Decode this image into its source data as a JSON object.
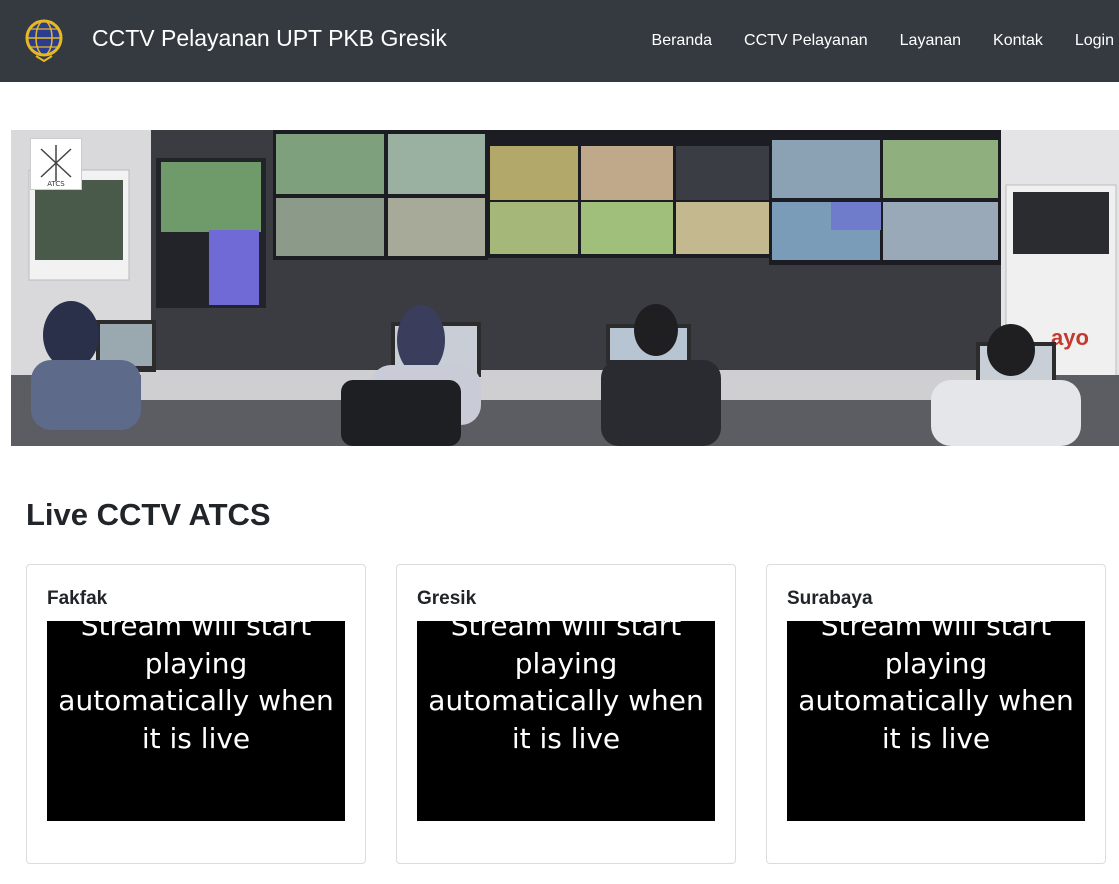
{
  "navbar": {
    "brand_title": "CCTV Pelayanan UPT PKB Gresik",
    "brand_logo_icon": "globe-emblem-icon",
    "links": [
      {
        "label": "Beranda"
      },
      {
        "label": "CCTV Pelayanan"
      },
      {
        "label": "Layanan"
      },
      {
        "label": "Kontak"
      },
      {
        "label": "Login"
      }
    ],
    "background": "#343a40"
  },
  "hero": {
    "badge_text": "ATCS",
    "image_description_icon": "control-room-photo"
  },
  "main": {
    "section_title": "Live CCTV ATCS",
    "cards": [
      {
        "title": "Fakfak",
        "player_message": "Stream will start playing automatically when it is live"
      },
      {
        "title": "Gresik",
        "player_message": "Stream will start playing automatically when it is live"
      },
      {
        "title": "Surabaya",
        "player_message": "Stream will start playing automatically when it is live"
      }
    ]
  }
}
